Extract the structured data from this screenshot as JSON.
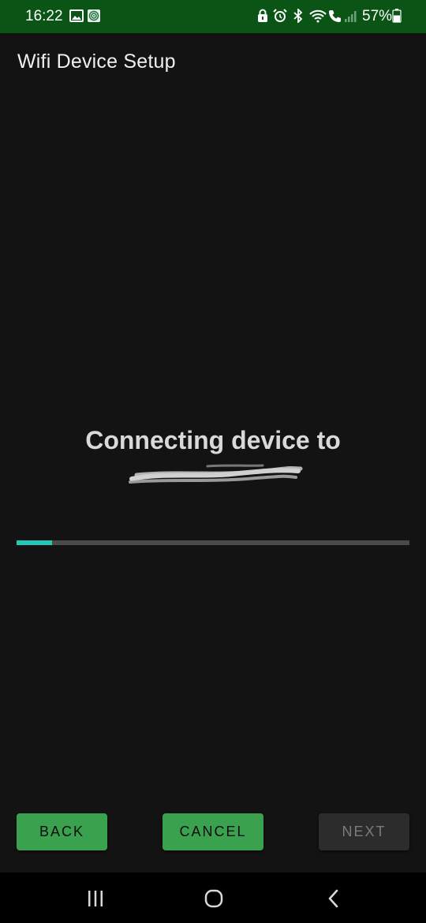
{
  "status_bar": {
    "time": "16:22",
    "battery_percent": "57%",
    "battery_level": 0.57,
    "left_icons": [
      "image-icon",
      "cast-icon"
    ],
    "right_icons": [
      "lock-icon",
      "alarm-icon",
      "bluetooth-icon",
      "wifi-icon",
      "call-icon",
      "signal-icon",
      "battery-icon"
    ]
  },
  "app_bar": {
    "title": "Wifi Device Setup"
  },
  "main": {
    "message": "Connecting device to",
    "progress": 0.09,
    "progress_color": "#22c9b8"
  },
  "buttons": {
    "back_label": "BACK",
    "cancel_label": "CANCEL",
    "next_label": "NEXT"
  },
  "nav_bar": {
    "icons": [
      "recent-apps-icon",
      "home-icon",
      "back-icon"
    ]
  },
  "colors": {
    "status_bar": "#0a5516",
    "button_green": "#3aa24f",
    "background": "#131313"
  }
}
